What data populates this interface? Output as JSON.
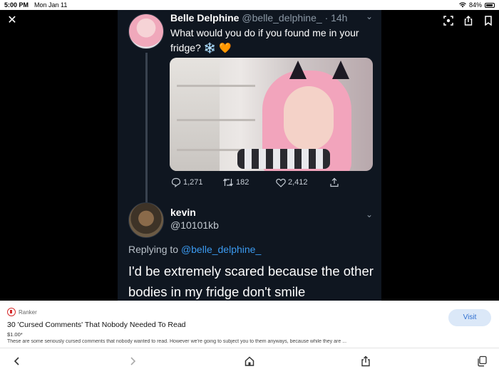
{
  "status_bar": {
    "time": "5:00 PM",
    "date": "Mon Jan 11",
    "battery": "84%",
    "icons": [
      "wifi-icon",
      "battery-icon"
    ]
  },
  "viewer": {
    "close_glyph": "✕",
    "tools": [
      "lens-search-icon",
      "share-icon",
      "bookmark-icon"
    ]
  },
  "tweet": {
    "display_name": "Belle Delphine",
    "handle": "@belle_delphine_",
    "time": "· 14h",
    "text": "What would you do if you found me in your fridge? ❄️ 🧡",
    "stats": {
      "replies": "1,271",
      "retweets": "182",
      "likes": "2,412"
    }
  },
  "reply": {
    "display_name": "kevin",
    "handle": "@10101kb",
    "replying_prefix": "Replying to ",
    "replying_to": "@belle_delphine_",
    "text": "I'd be extremely scared because the other bodies in my fridge don't smile"
  },
  "ad": {
    "source": "Ranker",
    "title": "30 'Cursed Comments' That Nobody Needed To Read",
    "price": "$1.00*",
    "description": "These are some seriously cursed comments that nobody wanted to read. However we're going to subject you to them anyways, because while they are ...",
    "cta": "Visit",
    "colors": {
      "cta_bg": "#dbe8f8",
      "cta_text": "#2f6fd0",
      "logo": "#d42a2a"
    }
  },
  "bottom_bar": {
    "buttons": [
      "back-icon",
      "forward-icon",
      "home-icon",
      "share-icon",
      "tabs-icon"
    ]
  },
  "colors": {
    "tweet_bg": "#0f1620",
    "link_blue": "#3b9af0"
  }
}
